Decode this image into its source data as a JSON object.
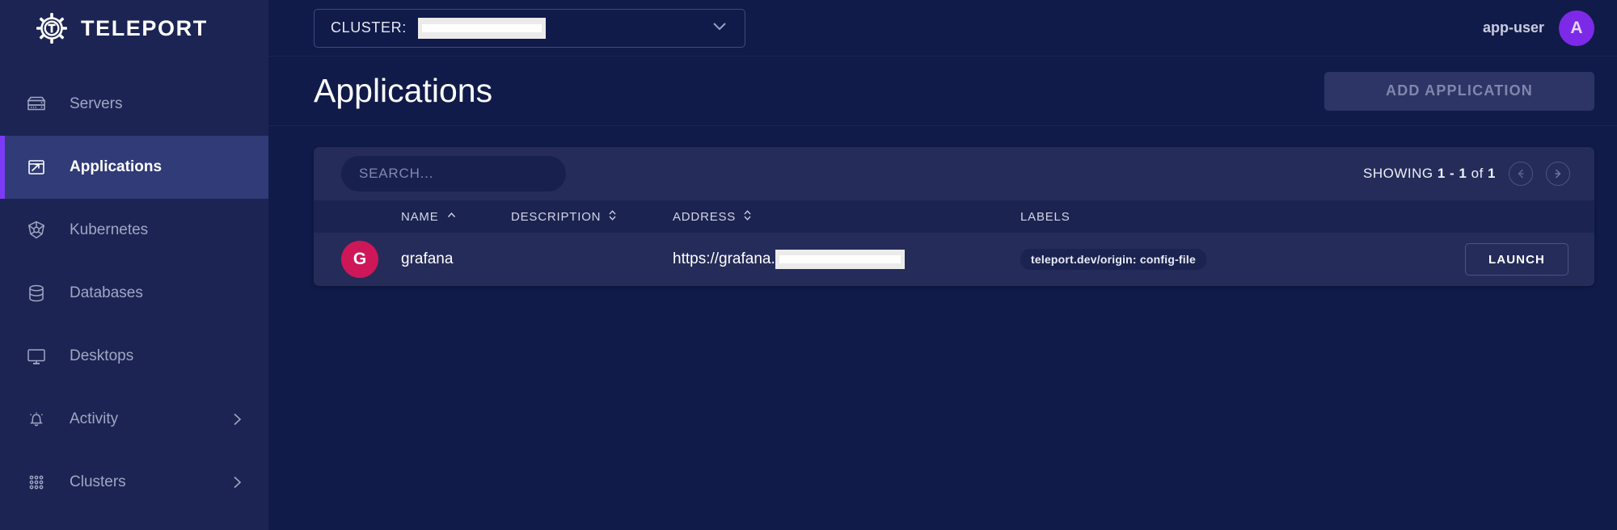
{
  "brand": {
    "name": "TELEPORT",
    "logo_icon": "teleport-gear-logo-icon"
  },
  "sidebar": {
    "items": [
      {
        "label": "Servers",
        "icon": "server-icon",
        "active": false,
        "expandable": false
      },
      {
        "label": "Applications",
        "icon": "application-icon",
        "active": true,
        "expandable": false
      },
      {
        "label": "Kubernetes",
        "icon": "kubernetes-icon",
        "active": false,
        "expandable": false
      },
      {
        "label": "Databases",
        "icon": "database-icon",
        "active": false,
        "expandable": false
      },
      {
        "label": "Desktops",
        "icon": "desktop-icon",
        "active": false,
        "expandable": false
      },
      {
        "label": "Activity",
        "icon": "bell-icon",
        "active": false,
        "expandable": true
      },
      {
        "label": "Clusters",
        "icon": "grid-dots-icon",
        "active": false,
        "expandable": true
      }
    ]
  },
  "topbar": {
    "cluster_label": "CLUSTER:",
    "cluster_value": "",
    "cluster_value_redacted": true,
    "caret_icon": "chevron-down-icon",
    "user_name": "app-user",
    "avatar_initial": "A"
  },
  "page": {
    "title": "Applications",
    "add_button": "ADD APPLICATION"
  },
  "toolbar": {
    "search_placeholder": "SEARCH...",
    "search_value": "",
    "showing_prefix": "SHOWING",
    "showing_range": "1 - 1",
    "showing_middle": "of",
    "showing_total": "1",
    "prev_icon": "arrow-left-circle-icon",
    "next_icon": "arrow-right-circle-icon"
  },
  "table": {
    "columns": [
      {
        "key": "icon",
        "label": "",
        "sort": "none"
      },
      {
        "key": "name",
        "label": "NAME",
        "sort": "asc"
      },
      {
        "key": "desc",
        "label": "DESCRIPTION",
        "sort": "both"
      },
      {
        "key": "addr",
        "label": "ADDRESS",
        "sort": "both"
      },
      {
        "key": "labels",
        "label": "LABELS",
        "sort": "none"
      },
      {
        "key": "action",
        "label": "",
        "sort": "none"
      }
    ],
    "rows": [
      {
        "avatar_initial": "G",
        "name": "grafana",
        "description": "",
        "address": "https://grafana.",
        "address_redacted": true,
        "labels": [
          "teleport.dev/origin: config-file"
        ],
        "action_label": "LAUNCH"
      }
    ]
  },
  "colors": {
    "sidebar_bg": "#1C2453",
    "main_bg": "#101B49",
    "card_bg": "#252C59",
    "header_row_bg": "#1B2350",
    "accent_purple": "#7B3BF5",
    "avatar_purple": "#7D2AE8",
    "app_avatar_pink": "#CE1759"
  }
}
